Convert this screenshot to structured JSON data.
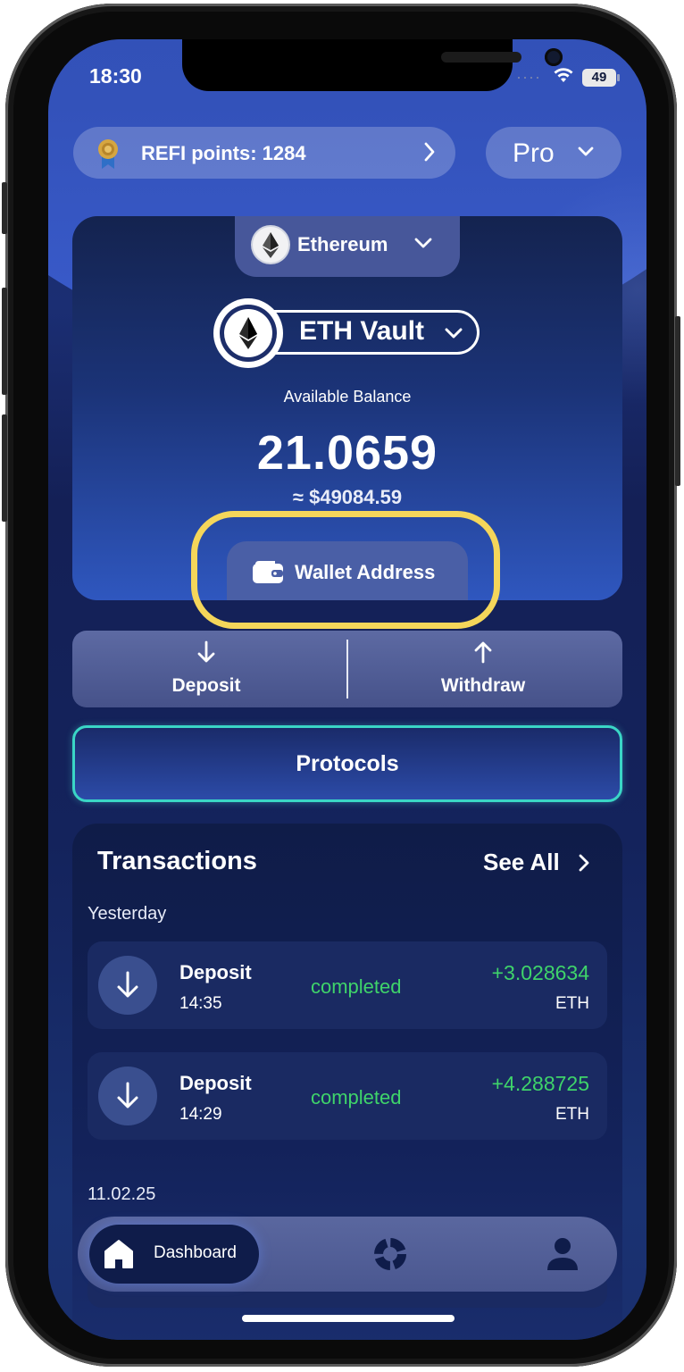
{
  "status_bar": {
    "time": "18:30",
    "battery": "49"
  },
  "header": {
    "refi_points": "REFI points: 1284",
    "plan_selector": "Pro"
  },
  "vault_card": {
    "network": "Ethereum",
    "vault_name": "ETH Vault",
    "balance_label": "Available Balance",
    "balance": "21.0659",
    "balance_usd": "≈ $49084.59",
    "wallet_address_label": "Wallet Address"
  },
  "actions": {
    "deposit_label": "Deposit",
    "withdraw_label": "Withdraw"
  },
  "protocols_label": "Protocols",
  "transactions": {
    "title": "Transactions",
    "see_all": "See All",
    "groups": [
      {
        "date": "Yesterday",
        "items": [
          {
            "type": "Deposit",
            "time": "14:35",
            "status": "completed",
            "amount": "+3.028634",
            "unit": "ETH"
          },
          {
            "type": "Deposit",
            "time": "14:29",
            "status": "completed",
            "amount": "+4.288725",
            "unit": "ETH"
          }
        ]
      },
      {
        "date": "11.02.25",
        "items": []
      }
    ]
  },
  "bottom_nav": {
    "dashboard_label": "Dashboard"
  },
  "colors": {
    "highlight": "#f5d65a",
    "positive": "#3fd46a",
    "protocols_border": "#3ad6c6"
  },
  "icons": [
    "medal-icon",
    "chevron-right-icon",
    "chevron-down-icon",
    "ethereum-icon",
    "wallet-icon",
    "arrow-down-icon",
    "arrow-up-icon",
    "home-icon",
    "portfolio-icon",
    "user-icon",
    "wifi-icon",
    "battery-icon"
  ]
}
